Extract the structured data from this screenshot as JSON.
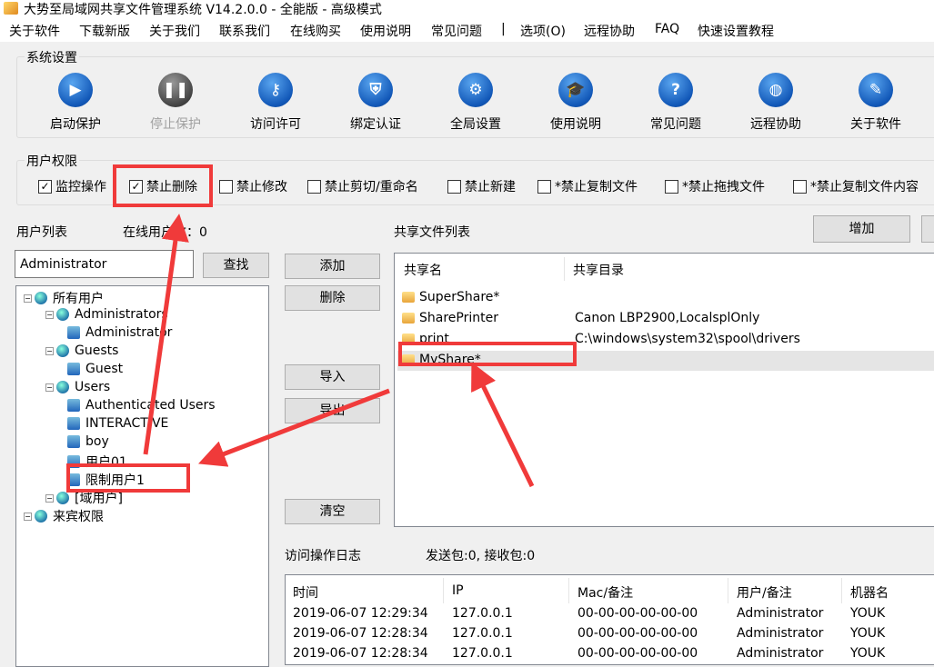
{
  "window": {
    "title": "大势至局域网共享文件管理系统 V14.2.0.0 - 全能版 - 高级模式"
  },
  "menu": [
    "关于软件",
    "下载新版",
    "关于我们",
    "联系我们",
    "在线购买",
    "使用说明",
    "常见问题",
    "|",
    "选项(O)",
    "远程协助",
    "FAQ",
    "快速设置教程"
  ],
  "system_settings": {
    "label": "系统设置",
    "tools": [
      {
        "label": "启动保护",
        "icon": "play-icon",
        "enabled": true
      },
      {
        "label": "停止保护",
        "icon": "pause-icon",
        "enabled": false
      },
      {
        "label": "访问许可",
        "icon": "key-icon",
        "enabled": true
      },
      {
        "label": "绑定认证",
        "icon": "shield-icon",
        "enabled": true
      },
      {
        "label": "全局设置",
        "icon": "gear-icon",
        "enabled": true
      },
      {
        "label": "使用说明",
        "icon": "graduation-cap-icon",
        "enabled": true
      },
      {
        "label": "常见问题",
        "icon": "question-icon",
        "enabled": true
      },
      {
        "label": "远程协助",
        "icon": "globe-icon",
        "enabled": true
      },
      {
        "label": "关于软件",
        "icon": "edit-icon",
        "enabled": true
      }
    ]
  },
  "permissions": {
    "label": "用户权限",
    "items": [
      {
        "label": "监控操作",
        "checked": true
      },
      {
        "label": "禁止删除",
        "checked": true
      },
      {
        "label": "禁止修改",
        "checked": false
      },
      {
        "label": "禁止剪切/重命名",
        "checked": false
      },
      {
        "label": "禁止新建",
        "checked": false
      },
      {
        "label": "*禁止复制文件",
        "checked": false
      },
      {
        "label": "*禁止拖拽文件",
        "checked": false
      },
      {
        "label": "*禁止复制文件内容",
        "checked": false
      }
    ]
  },
  "users": {
    "label": "用户列表",
    "online": "在线用户数：0",
    "search_value": "Administrator",
    "search_button": "查找",
    "tree": [
      {
        "label": "所有用户",
        "level": 0,
        "type": "group"
      },
      {
        "label": "Administrators",
        "level": 1,
        "type": "group"
      },
      {
        "label": "Administrator",
        "level": 2,
        "type": "user"
      },
      {
        "label": "Guests",
        "level": 1,
        "type": "group"
      },
      {
        "label": "Guest",
        "level": 2,
        "type": "user"
      },
      {
        "label": "Users",
        "level": 1,
        "type": "group"
      },
      {
        "label": "Authenticated Users",
        "level": 2,
        "type": "user"
      },
      {
        "label": "INTERACTIVE",
        "level": 2,
        "type": "user"
      },
      {
        "label": "boy",
        "level": 2,
        "type": "user"
      },
      {
        "label": "用户01",
        "level": 2,
        "type": "user"
      },
      {
        "label": "限制用户1",
        "level": 2,
        "type": "user"
      },
      {
        "label": "[域用户]",
        "level": 1,
        "type": "group"
      },
      {
        "label": "来宾权限",
        "level": 0,
        "type": "group"
      }
    ]
  },
  "middle_buttons": {
    "add": "添加",
    "delete": "删除",
    "import": "导入",
    "export": "导出",
    "clear": "清空"
  },
  "shares": {
    "label": "共享文件列表",
    "add_button": "增加",
    "columns": [
      "共享名",
      "共享目录"
    ],
    "rows": [
      [
        "SuperShare*",
        ""
      ],
      [
        "SharePrinter",
        "Canon LBP2900,LocalsplOnly"
      ],
      [
        "print",
        "C:\\windows\\system32\\spool\\drivers"
      ],
      [
        "MyShare*",
        ""
      ]
    ],
    "selected": 3
  },
  "log": {
    "label": "访问操作日志",
    "stats": "发送包:0, 接收包:0",
    "columns": [
      "时间",
      "IP",
      "Mac/备注",
      "用户/备注",
      "机器名"
    ],
    "rows": [
      [
        "2019-06-07 12:29:34",
        "127.0.0.1",
        "00-00-00-00-00-00",
        "Administrator",
        "YOUK"
      ],
      [
        "2019-06-07 12:28:34",
        "127.0.0.1",
        "00-00-00-00-00-00",
        "Administrator",
        "YOUK"
      ],
      [
        "2019-06-07 12:28:34",
        "127.0.0.1",
        "00-00-00-00-00-00",
        "Administrator",
        "YOUK"
      ]
    ]
  },
  "colors": {
    "annotation": "#f03a3a",
    "selection": "#e5e5e5"
  }
}
